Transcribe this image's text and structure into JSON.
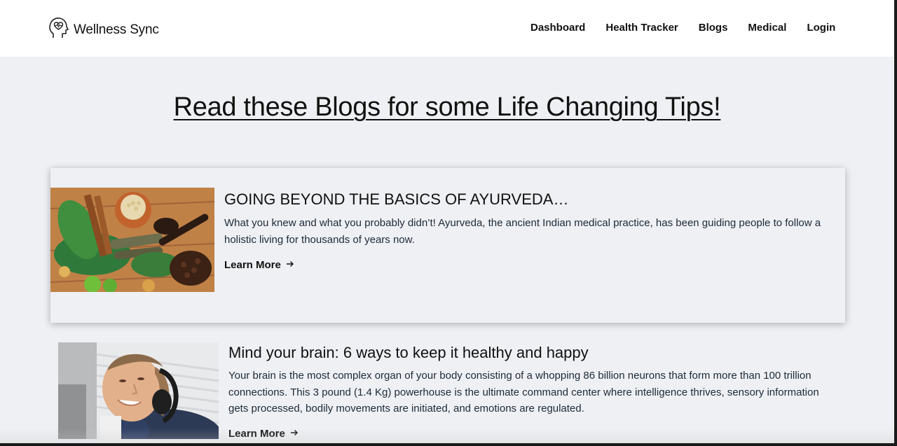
{
  "header": {
    "brand": "Wellness Sync",
    "logo_icon": "head-heart-icon",
    "nav": [
      {
        "label": "Dashboard"
      },
      {
        "label": "Health Tracker"
      },
      {
        "label": "Blogs"
      },
      {
        "label": "Medical"
      },
      {
        "label": "Login"
      }
    ]
  },
  "page": {
    "heading": "Read these Blogs for some Life Changing Tips!"
  },
  "posts": [
    {
      "title": "GOING BEYOND THE BASICS OF AYURVEDA…",
      "excerpt": "What you knew and what you probably didn’t! Ayurveda, the ancient Indian medical practice, has been guiding people to follow a holistic living for thousands of years now.",
      "cta": "Learn More",
      "image": "ayurveda-herbs-spices"
    },
    {
      "title": "Mind your brain: 6 ways to keep it healthy and happy",
      "excerpt": "Your brain is the most complex organ of your body consisting of a whopping 86 billion neurons that form more than 100 trillion connections. This 3 pound (1.4 Kg) powerhouse is the ultimate command center where intelligence thrives, sensory information gets processed, bodily movements are initiated, and emotions are regulated.",
      "cta": "Learn More",
      "image": "man-with-headphones-relaxing"
    }
  ],
  "colors": {
    "header_bg": "#ffffff",
    "page_bg": "#eef0f3",
    "text": "#111827"
  }
}
